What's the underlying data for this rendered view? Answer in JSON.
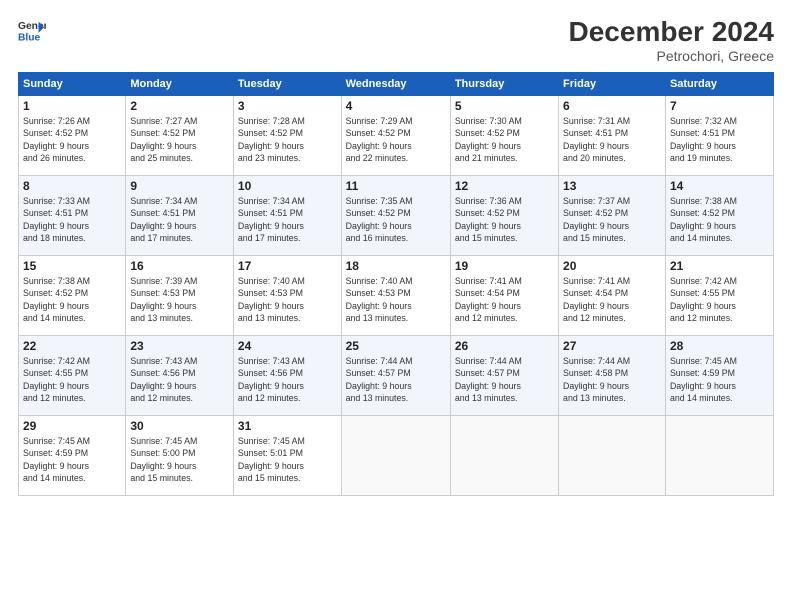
{
  "header": {
    "logo_line1": "General",
    "logo_line2": "Blue",
    "title": "December 2024",
    "subtitle": "Petrochori, Greece"
  },
  "weekdays": [
    "Sunday",
    "Monday",
    "Tuesday",
    "Wednesday",
    "Thursday",
    "Friday",
    "Saturday"
  ],
  "weeks": [
    [
      {
        "day": "1",
        "info": "Sunrise: 7:26 AM\nSunset: 4:52 PM\nDaylight: 9 hours\nand 26 minutes."
      },
      {
        "day": "2",
        "info": "Sunrise: 7:27 AM\nSunset: 4:52 PM\nDaylight: 9 hours\nand 25 minutes."
      },
      {
        "day": "3",
        "info": "Sunrise: 7:28 AM\nSunset: 4:52 PM\nDaylight: 9 hours\nand 23 minutes."
      },
      {
        "day": "4",
        "info": "Sunrise: 7:29 AM\nSunset: 4:52 PM\nDaylight: 9 hours\nand 22 minutes."
      },
      {
        "day": "5",
        "info": "Sunrise: 7:30 AM\nSunset: 4:52 PM\nDaylight: 9 hours\nand 21 minutes."
      },
      {
        "day": "6",
        "info": "Sunrise: 7:31 AM\nSunset: 4:51 PM\nDaylight: 9 hours\nand 20 minutes."
      },
      {
        "day": "7",
        "info": "Sunrise: 7:32 AM\nSunset: 4:51 PM\nDaylight: 9 hours\nand 19 minutes."
      }
    ],
    [
      {
        "day": "8",
        "info": "Sunrise: 7:33 AM\nSunset: 4:51 PM\nDaylight: 9 hours\nand 18 minutes."
      },
      {
        "day": "9",
        "info": "Sunrise: 7:34 AM\nSunset: 4:51 PM\nDaylight: 9 hours\nand 17 minutes."
      },
      {
        "day": "10",
        "info": "Sunrise: 7:34 AM\nSunset: 4:51 PM\nDaylight: 9 hours\nand 17 minutes."
      },
      {
        "day": "11",
        "info": "Sunrise: 7:35 AM\nSunset: 4:52 PM\nDaylight: 9 hours\nand 16 minutes."
      },
      {
        "day": "12",
        "info": "Sunrise: 7:36 AM\nSunset: 4:52 PM\nDaylight: 9 hours\nand 15 minutes."
      },
      {
        "day": "13",
        "info": "Sunrise: 7:37 AM\nSunset: 4:52 PM\nDaylight: 9 hours\nand 15 minutes."
      },
      {
        "day": "14",
        "info": "Sunrise: 7:38 AM\nSunset: 4:52 PM\nDaylight: 9 hours\nand 14 minutes."
      }
    ],
    [
      {
        "day": "15",
        "info": "Sunrise: 7:38 AM\nSunset: 4:52 PM\nDaylight: 9 hours\nand 14 minutes."
      },
      {
        "day": "16",
        "info": "Sunrise: 7:39 AM\nSunset: 4:53 PM\nDaylight: 9 hours\nand 13 minutes."
      },
      {
        "day": "17",
        "info": "Sunrise: 7:40 AM\nSunset: 4:53 PM\nDaylight: 9 hours\nand 13 minutes."
      },
      {
        "day": "18",
        "info": "Sunrise: 7:40 AM\nSunset: 4:53 PM\nDaylight: 9 hours\nand 13 minutes."
      },
      {
        "day": "19",
        "info": "Sunrise: 7:41 AM\nSunset: 4:54 PM\nDaylight: 9 hours\nand 12 minutes."
      },
      {
        "day": "20",
        "info": "Sunrise: 7:41 AM\nSunset: 4:54 PM\nDaylight: 9 hours\nand 12 minutes."
      },
      {
        "day": "21",
        "info": "Sunrise: 7:42 AM\nSunset: 4:55 PM\nDaylight: 9 hours\nand 12 minutes."
      }
    ],
    [
      {
        "day": "22",
        "info": "Sunrise: 7:42 AM\nSunset: 4:55 PM\nDaylight: 9 hours\nand 12 minutes."
      },
      {
        "day": "23",
        "info": "Sunrise: 7:43 AM\nSunset: 4:56 PM\nDaylight: 9 hours\nand 12 minutes."
      },
      {
        "day": "24",
        "info": "Sunrise: 7:43 AM\nSunset: 4:56 PM\nDaylight: 9 hours\nand 12 minutes."
      },
      {
        "day": "25",
        "info": "Sunrise: 7:44 AM\nSunset: 4:57 PM\nDaylight: 9 hours\nand 13 minutes."
      },
      {
        "day": "26",
        "info": "Sunrise: 7:44 AM\nSunset: 4:57 PM\nDaylight: 9 hours\nand 13 minutes."
      },
      {
        "day": "27",
        "info": "Sunrise: 7:44 AM\nSunset: 4:58 PM\nDaylight: 9 hours\nand 13 minutes."
      },
      {
        "day": "28",
        "info": "Sunrise: 7:45 AM\nSunset: 4:59 PM\nDaylight: 9 hours\nand 14 minutes."
      }
    ],
    [
      {
        "day": "29",
        "info": "Sunrise: 7:45 AM\nSunset: 4:59 PM\nDaylight: 9 hours\nand 14 minutes."
      },
      {
        "day": "30",
        "info": "Sunrise: 7:45 AM\nSunset: 5:00 PM\nDaylight: 9 hours\nand 15 minutes."
      },
      {
        "day": "31",
        "info": "Sunrise: 7:45 AM\nSunset: 5:01 PM\nDaylight: 9 hours\nand 15 minutes."
      },
      null,
      null,
      null,
      null
    ]
  ]
}
